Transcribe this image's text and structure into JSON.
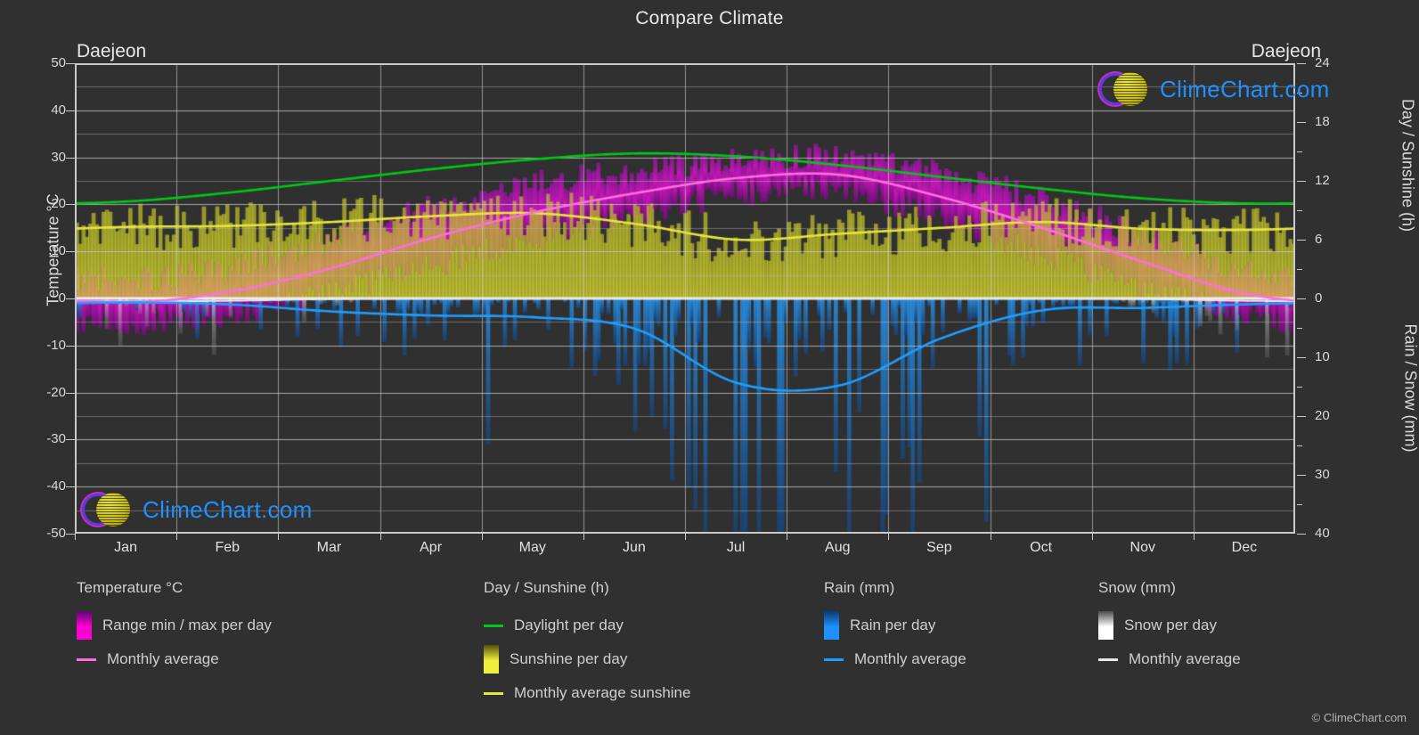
{
  "header": {
    "title": "Compare Climate",
    "city_left": "Daejeon",
    "city_right": "Daejeon"
  },
  "branding": {
    "watermark_text": "ClimeChart.com",
    "copyright": "© ClimeChart.com",
    "logo_icon": "climechart-logo-icon",
    "accent_blue": "#1e90ff",
    "accent_magenta": "#c828c8",
    "accent_yellow": "#c8bc14"
  },
  "axes": {
    "left": {
      "title": "Temperature °C",
      "ticks": [
        50,
        40,
        30,
        20,
        10,
        0,
        -10,
        -20,
        -30,
        -40,
        -50
      ],
      "min": -50,
      "max": 50
    },
    "right_top": {
      "title": "Day / Sunshine (h)",
      "ticks": [
        24,
        18,
        12,
        6,
        0
      ],
      "min": 0,
      "max": 24
    },
    "right_bottom": {
      "title": "Rain / Snow (mm)",
      "ticks": [
        0,
        10,
        20,
        30,
        40
      ],
      "min": 0,
      "max": 40
    },
    "x": {
      "ticks": [
        "Jan",
        "Feb",
        "Mar",
        "Apr",
        "May",
        "Jun",
        "Jul",
        "Aug",
        "Sep",
        "Oct",
        "Nov",
        "Dec"
      ]
    }
  },
  "legend": {
    "groups": [
      {
        "title": "Temperature °C",
        "items": [
          {
            "label": "Range min / max per day",
            "marker": "swatch",
            "color": "#ff00d4",
            "color2": "#5a0a6e"
          },
          {
            "label": "Monthly average",
            "marker": "line",
            "color": "#ff6ee0"
          }
        ]
      },
      {
        "title": "Day / Sunshine (h)",
        "items": [
          {
            "label": "Daylight per day",
            "marker": "line",
            "color": "#00c814"
          },
          {
            "label": "Sunshine per day",
            "marker": "swatch",
            "color": "#f0f03c",
            "color2": "#55500a"
          },
          {
            "label": "Monthly average sunshine",
            "marker": "line",
            "color": "#e6e63c"
          }
        ]
      },
      {
        "title": "Rain (mm)",
        "items": [
          {
            "label": "Rain per day",
            "marker": "swatch",
            "color": "#1e90ff",
            "color2": "#0a3a6e"
          },
          {
            "label": "Monthly average",
            "marker": "line",
            "color": "#1e9eff"
          }
        ]
      },
      {
        "title": "Snow (mm)",
        "items": [
          {
            "label": "Snow per day",
            "marker": "swatch",
            "color": "#ffffff",
            "color2": "#4a4a4a"
          },
          {
            "label": "Monthly average",
            "marker": "line",
            "color": "#e8e8e8"
          }
        ]
      }
    ]
  },
  "chart_data": {
    "type": "line",
    "title": "Compare Climate",
    "subtitle": "Daejeon",
    "xlabel": "",
    "ylabel": "Temperature °C",
    "ylim": [
      -50,
      50
    ],
    "grid": true,
    "legend_position": "below",
    "categories": [
      "Jan",
      "Feb",
      "Mar",
      "Apr",
      "May",
      "Jun",
      "Jul",
      "Aug",
      "Sep",
      "Oct",
      "Nov",
      "Dec"
    ],
    "series": [
      {
        "name": "Monthly average temperature",
        "axis": "left",
        "unit": "°C",
        "color": "#ff6ee0",
        "values": [
          -0.8,
          1.4,
          6.4,
          12.9,
          18.3,
          22.4,
          25.6,
          26.3,
          21.6,
          15.0,
          7.7,
          1.0
        ]
      },
      {
        "name": "Daylight per day",
        "axis": "right_top",
        "unit": "h",
        "color": "#00c814",
        "values": [
          9.9,
          10.8,
          12.0,
          13.2,
          14.2,
          14.8,
          14.5,
          13.6,
          12.4,
          11.2,
          10.2,
          9.7
        ]
      },
      {
        "name": "Monthly average sunshine",
        "axis": "right_top",
        "unit": "h",
        "color": "#e6e63c",
        "values": [
          7.3,
          7.4,
          7.8,
          8.4,
          8.7,
          7.6,
          6.0,
          6.6,
          7.2,
          7.8,
          7.1,
          7.0
        ]
      },
      {
        "name": "Monthly average rain",
        "axis": "right_bottom",
        "unit": "mm",
        "color": "#1e9eff",
        "values": [
          0.7,
          1.0,
          2.2,
          2.9,
          3.2,
          5.2,
          14.4,
          14.8,
          6.8,
          2.0,
          1.6,
          1.0
        ]
      },
      {
        "name": "Monthly average snow",
        "axis": "right_bottom",
        "unit": "mm",
        "color": "#e8e8e8",
        "values": [
          0.5,
          0.4,
          0.1,
          0.0,
          0.0,
          0.0,
          0.0,
          0.0,
          0.0,
          0.0,
          0.1,
          0.4
        ]
      }
    ],
    "bands": [
      {
        "name": "Temperature range min / max per day",
        "axis": "left",
        "unit": "°C",
        "min_values": [
          -5.6,
          -3.5,
          1.0,
          6.9,
          12.6,
          17.8,
          21.8,
          22.3,
          16.8,
          9.3,
          2.4,
          -3.4
        ],
        "max_values": [
          4.0,
          6.6,
          12.4,
          19.6,
          24.4,
          27.3,
          29.5,
          30.4,
          26.4,
          21.2,
          13.4,
          6.0
        ]
      }
    ]
  }
}
